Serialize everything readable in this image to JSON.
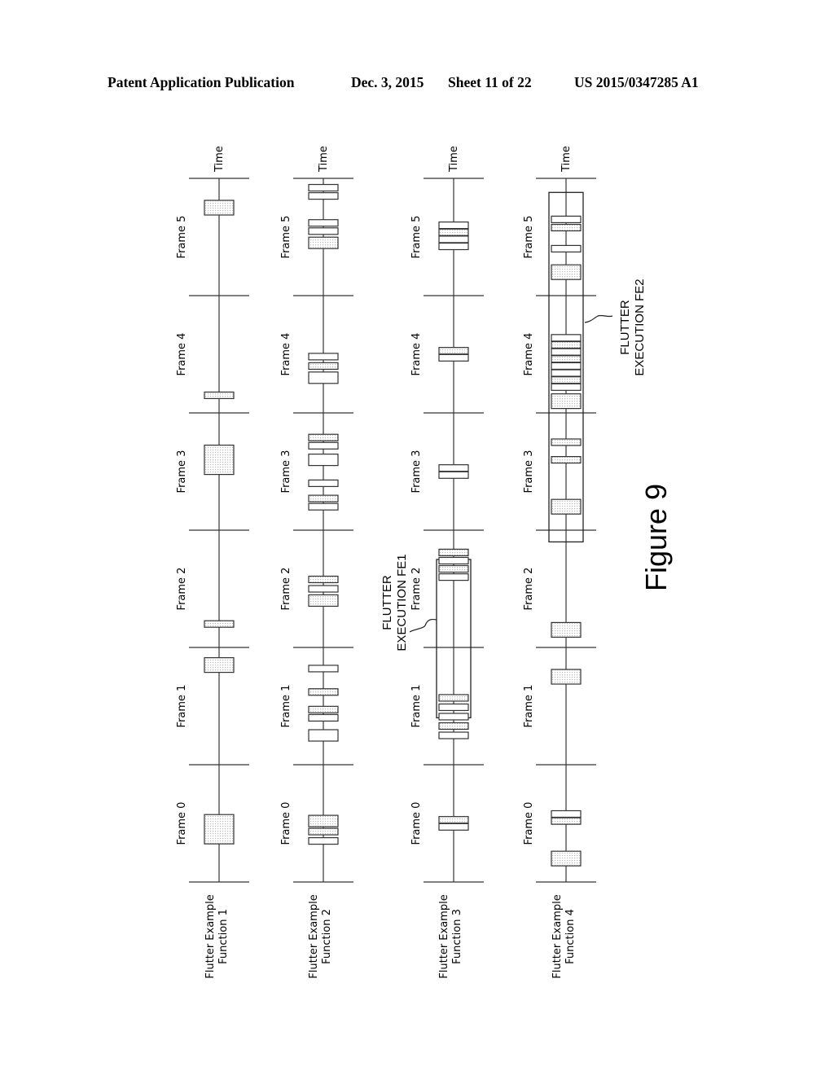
{
  "header": {
    "publication": "Patent Application Publication",
    "date": "Dec. 3, 2015",
    "sheet": "Sheet 11 of 22",
    "number": "US 2015/0347285 A1"
  },
  "figure": {
    "caption": "Figure 9",
    "axis_label": "Time",
    "frames": [
      "Frame 0",
      "Frame 1",
      "Frame 2",
      "Frame 3",
      "Frame 4",
      "Frame 5"
    ],
    "timelines": [
      {
        "label_line1": "Flutter Example",
        "label_line2": "Function 1",
        "blocks": [
          {
            "frame": 0,
            "pos": 0.45,
            "size": "large",
            "shaded": true
          },
          {
            "frame": 1,
            "pos": 0.85,
            "size": "medium",
            "shaded": true
          },
          {
            "frame": 2,
            "pos": 0.2,
            "size": "thin",
            "shaded": true
          },
          {
            "frame": 3,
            "pos": 0.6,
            "size": "large",
            "shaded": true
          },
          {
            "frame": 4,
            "pos": 0.15,
            "size": "thin",
            "shaded": true
          },
          {
            "frame": 5,
            "pos": 0.75,
            "size": "medium",
            "shaded": true
          }
        ]
      },
      {
        "label_line1": "Flutter Example",
        "label_line2": "Function 2",
        "blocks": [
          {
            "frame": 0,
            "pos": 0.35,
            "size": "thin",
            "shaded": false
          },
          {
            "frame": 0,
            "pos": 0.43,
            "size": "thin",
            "shaded": true
          },
          {
            "frame": 0,
            "pos": 0.52,
            "size": "small",
            "shaded": true
          },
          {
            "frame": 1,
            "pos": 0.25,
            "size": "small",
            "shaded": false
          },
          {
            "frame": 1,
            "pos": 0.4,
            "size": "thin",
            "shaded": false
          },
          {
            "frame": 1,
            "pos": 0.47,
            "size": "thin",
            "shaded": true
          },
          {
            "frame": 1,
            "pos": 0.62,
            "size": "thin",
            "shaded": true
          },
          {
            "frame": 1,
            "pos": 0.82,
            "size": "thin",
            "shaded": false
          },
          {
            "frame": 2,
            "pos": 0.4,
            "size": "small",
            "shaded": true
          },
          {
            "frame": 2,
            "pos": 0.5,
            "size": "thin",
            "shaded": false
          },
          {
            "frame": 2,
            "pos": 0.58,
            "size": "thin",
            "shaded": true
          },
          {
            "frame": 3,
            "pos": 0.2,
            "size": "thin",
            "shaded": false
          },
          {
            "frame": 3,
            "pos": 0.27,
            "size": "thin",
            "shaded": true
          },
          {
            "frame": 3,
            "pos": 0.4,
            "size": "thin",
            "shaded": false
          },
          {
            "frame": 3,
            "pos": 0.6,
            "size": "small",
            "shaded": false
          },
          {
            "frame": 3,
            "pos": 0.72,
            "size": "thin",
            "shaded": false
          },
          {
            "frame": 3,
            "pos": 0.79,
            "size": "thin",
            "shaded": true
          },
          {
            "frame": 4,
            "pos": 0.3,
            "size": "small",
            "shaded": false
          },
          {
            "frame": 4,
            "pos": 0.4,
            "size": "thin",
            "shaded": true
          },
          {
            "frame": 4,
            "pos": 0.48,
            "size": "thin",
            "shaded": false
          },
          {
            "frame": 5,
            "pos": 0.45,
            "size": "small",
            "shaded": true
          },
          {
            "frame": 5,
            "pos": 0.55,
            "size": "thin",
            "shaded": false
          },
          {
            "frame": 5,
            "pos": 0.62,
            "size": "thin",
            "shaded": false
          },
          {
            "frame": 5,
            "pos": 0.85,
            "size": "thin",
            "shaded": false
          },
          {
            "frame": 5,
            "pos": 0.92,
            "size": "thin",
            "shaded": false
          }
        ]
      },
      {
        "label_line1": "Flutter Example",
        "label_line2": "Function 3",
        "blocks": [
          {
            "frame": 0,
            "pos": 0.47,
            "size": "thin",
            "shaded": false
          },
          {
            "frame": 0,
            "pos": 0.53,
            "size": "thin",
            "shaded": true
          },
          {
            "frame": 1,
            "pos": 0.25,
            "size": "thin",
            "shaded": false
          },
          {
            "frame": 1,
            "pos": 0.33,
            "size": "thin",
            "shaded": true
          },
          {
            "frame": 1,
            "pos": 0.41,
            "size": "thin",
            "shaded": false
          },
          {
            "frame": 1,
            "pos": 0.49,
            "size": "thin",
            "shaded": false
          },
          {
            "frame": 1,
            "pos": 0.57,
            "size": "thin",
            "shaded": true
          },
          {
            "frame": 2,
            "pos": 0.6,
            "size": "thin",
            "shaded": false
          },
          {
            "frame": 2,
            "pos": 0.67,
            "size": "thin",
            "shaded": true
          },
          {
            "frame": 2,
            "pos": 0.74,
            "size": "thin",
            "shaded": false
          },
          {
            "frame": 2,
            "pos": 0.81,
            "size": "thin",
            "shaded": true
          },
          {
            "frame": 3,
            "pos": 0.47,
            "size": "thin",
            "shaded": false
          },
          {
            "frame": 3,
            "pos": 0.53,
            "size": "thin",
            "shaded": false
          },
          {
            "frame": 4,
            "pos": 0.47,
            "size": "thin",
            "shaded": false
          },
          {
            "frame": 4,
            "pos": 0.53,
            "size": "thin",
            "shaded": true
          },
          {
            "frame": 5,
            "pos": 0.42,
            "size": "thin",
            "shaded": false
          },
          {
            "frame": 5,
            "pos": 0.48,
            "size": "thin",
            "shaded": false
          },
          {
            "frame": 5,
            "pos": 0.54,
            "size": "thin",
            "shaded": true
          },
          {
            "frame": 5,
            "pos": 0.6,
            "size": "thin",
            "shaded": false
          }
        ],
        "highlight": {
          "label_line1": "FLUTTER",
          "label_line2": "EXECUTION FE1",
          "from": 1.4,
          "to": 2.75
        }
      },
      {
        "label_line1": "Flutter Example",
        "label_line2": "Function 4",
        "blocks": [
          {
            "frame": 0,
            "pos": 0.2,
            "size": "medium",
            "shaded": true
          },
          {
            "frame": 0,
            "pos": 0.52,
            "size": "thin",
            "shaded": true
          },
          {
            "frame": 0,
            "pos": 0.58,
            "size": "thin",
            "shaded": false
          },
          {
            "frame": 1,
            "pos": 0.75,
            "size": "medium",
            "shaded": true
          },
          {
            "frame": 2,
            "pos": 0.15,
            "size": "medium",
            "shaded": true
          },
          {
            "frame": 3,
            "pos": 0.2,
            "size": "medium",
            "shaded": true
          },
          {
            "frame": 3,
            "pos": 0.6,
            "size": "thin",
            "shaded": true
          },
          {
            "frame": 3,
            "pos": 0.75,
            "size": "thin",
            "shaded": true
          },
          {
            "frame": 4,
            "pos": 0.1,
            "size": "medium",
            "shaded": true
          },
          {
            "frame": 4,
            "pos": 0.22,
            "size": "thin",
            "shaded": false
          },
          {
            "frame": 4,
            "pos": 0.28,
            "size": "thin",
            "shaded": true
          },
          {
            "frame": 4,
            "pos": 0.34,
            "size": "thin",
            "shaded": false
          },
          {
            "frame": 4,
            "pos": 0.4,
            "size": "thin",
            "shaded": false
          },
          {
            "frame": 4,
            "pos": 0.46,
            "size": "thin",
            "shaded": true
          },
          {
            "frame": 4,
            "pos": 0.52,
            "size": "thin",
            "shaded": false
          },
          {
            "frame": 4,
            "pos": 0.58,
            "size": "thin",
            "shaded": true
          },
          {
            "frame": 4,
            "pos": 0.64,
            "size": "thin",
            "shaded": false
          },
          {
            "frame": 5,
            "pos": 0.2,
            "size": "medium",
            "shaded": true
          },
          {
            "frame": 5,
            "pos": 0.4,
            "size": "thin",
            "shaded": false
          },
          {
            "frame": 5,
            "pos": 0.58,
            "size": "thin",
            "shaded": true
          },
          {
            "frame": 5,
            "pos": 0.65,
            "size": "thin",
            "shaded": false
          }
        ],
        "highlight": {
          "label_line1": "FLUTTER",
          "label_line2": "EXECUTION FE2",
          "from": 2.9,
          "to": 5.88
        }
      }
    ]
  }
}
